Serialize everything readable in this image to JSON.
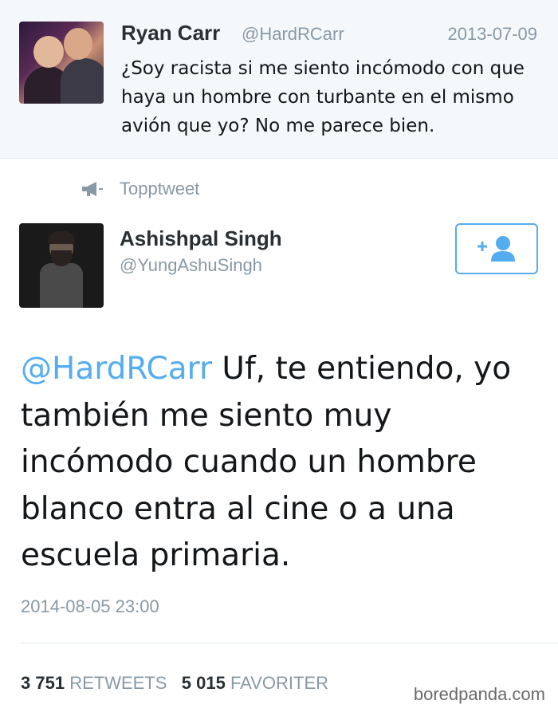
{
  "reply_tweet": {
    "name": "Ryan Carr",
    "handle": "@HardRCarr",
    "date": "2013-07-09",
    "text": "¿Soy racista si me siento incómodo con que haya un hombre con turbante en el mismo avión que yo? No me parece bien."
  },
  "retweet_context": {
    "label": "Topptweet",
    "icon": "megaphone-icon"
  },
  "main_tweet": {
    "name": "Ashishpal Singh",
    "handle": "@YungAshuSingh",
    "follow_icon": "add-user-icon",
    "mention": "@HardRCarr",
    "text": " Uf, te entiendo, yo también me siento muy incómodo cuando un hombre blanco entra al cine o a una escuela primaria.",
    "timestamp": "2014-08-05 23:00",
    "retweets_count": "3 751",
    "retweets_label": "RETWEETS",
    "favorites_count": "5 015",
    "favorites_label": "FAVORITER"
  },
  "watermark": "boredpanda.com",
  "colors": {
    "accent": "#55acee",
    "muted_text": "#8899a6",
    "reply_background": "#f5f8fa"
  }
}
